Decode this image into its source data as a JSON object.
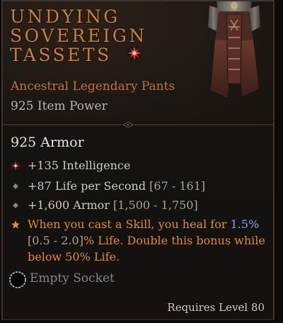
{
  "item": {
    "name_line1": "Undying",
    "name_line2": "Sovereign",
    "name_line3": "Tassets",
    "type": "Ancestral Legendary Pants",
    "item_power": "925 Item Power",
    "armor": "925 Armor"
  },
  "affixes": [
    {
      "text": "+135 Intelligence",
      "range": "",
      "bullet_icon": "red-starburst-icon"
    },
    {
      "text": "+87 Life per Second ",
      "range": "[67 - 161]",
      "bullet_icon": "grey-diamond-icon"
    },
    {
      "text": "+1,600 Armor ",
      "range": "[1,500 - 1,750]",
      "bullet_icon": "grey-diamond-icon"
    }
  ],
  "legendary_aspect": {
    "bullet_icon": "orange-star-icon",
    "part1": "When you cast a Skill, you heal for ",
    "value": "1.5%",
    "range": "[0.5 - 2.0]",
    "part2": "% Life. Double this bonus while",
    "part3": "below 50% Life."
  },
  "socket": {
    "label": "Empty Socket"
  },
  "requirements": {
    "level_text": "Requires Level 80"
  },
  "colors": {
    "legendary_orange": "#e08a35",
    "item_name": "#c9813a",
    "value_blue": "#8a9cf0",
    "text": "#cfc8bd"
  }
}
